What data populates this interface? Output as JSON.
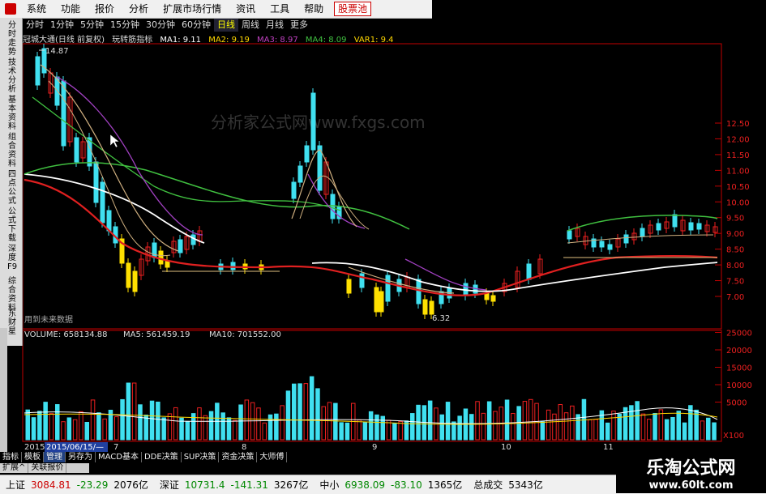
{
  "menu": [
    "系统",
    "功能",
    "报价",
    "分析",
    "扩展市场行情",
    "资讯",
    "工具",
    "帮助",
    "股票池"
  ],
  "periods": [
    "分时",
    "1分钟",
    "5分钟",
    "15分钟",
    "30分钟",
    "60分钟",
    "日线",
    "周线",
    "月线",
    "更多"
  ],
  "active_period": "日线",
  "side_tabs": [
    "分时走势",
    "技术分析",
    "基本资料",
    "组合资料",
    "四点公式",
    "公式下载",
    "深度F9",
    "综合资料",
    "东财星"
  ],
  "chart_title": {
    "stock": "冠城大通(日线 前复权)",
    "indicator": "玩转筋指标",
    "ma1": "MA1: 9.11",
    "ma2": "MA2: 9.19",
    "ma3": "MA3: 8.97",
    "ma4": "MA4: 8.09",
    "var1": "VAR1: 9.4"
  },
  "price_axis": [
    "12.50",
    "12.00",
    "11.50",
    "11.00",
    "10.50",
    "10.00",
    "9.50",
    "9.00",
    "8.50",
    "8.00",
    "7.50",
    "7.00"
  ],
  "high_label": "14.87",
  "low_label": "6.32",
  "watermark": "分析家公式网www.fxgs.com",
  "future_label": "用到未来数据",
  "volume_title": {
    "vol": "VOLUME: 658134.88",
    "ma5": "MA5: 561459.19",
    "ma10": "MA10: 701552.00"
  },
  "volume_axis": [
    "25000",
    "20000",
    "15000",
    "10000",
    "5000"
  ],
  "volume_unit": "X100",
  "date_labels": [
    "2015",
    "2015/06/15/—",
    "7",
    "8",
    "9",
    "10",
    "11"
  ],
  "bottom_tabs": [
    "指标",
    "模板",
    "管理",
    "另存为",
    "MACD基本",
    "DDE决策",
    "SUP决策",
    "资金决策",
    "大师傅"
  ],
  "bottom_sidebar": [
    "扩展^",
    "关联报价"
  ],
  "status": [
    {
      "label": "上证",
      "value": "3084.81",
      "change": "-23.29",
      "amount": "2076亿"
    },
    {
      "label": "深证",
      "value": "10731.4",
      "change": "-141.31",
      "amount": "3267亿"
    },
    {
      "label": "中小",
      "value": "6938.09",
      "change": "-83.10",
      "amount": "1365亿"
    },
    {
      "label": "总成交",
      "value": "5343亿"
    }
  ],
  "logo": {
    "cn": "乐淘公式网",
    "url": "www.60lt.com"
  },
  "colors": {
    "up": "#ee2020",
    "down": "#40e0f0",
    "limit_down": "#ffe000",
    "ma_white": "#ffffff",
    "ma_red": "#e02020",
    "ma_green": "#40c040",
    "ma_purple": "#a040c0",
    "ma_tan": "#d0b080"
  }
}
